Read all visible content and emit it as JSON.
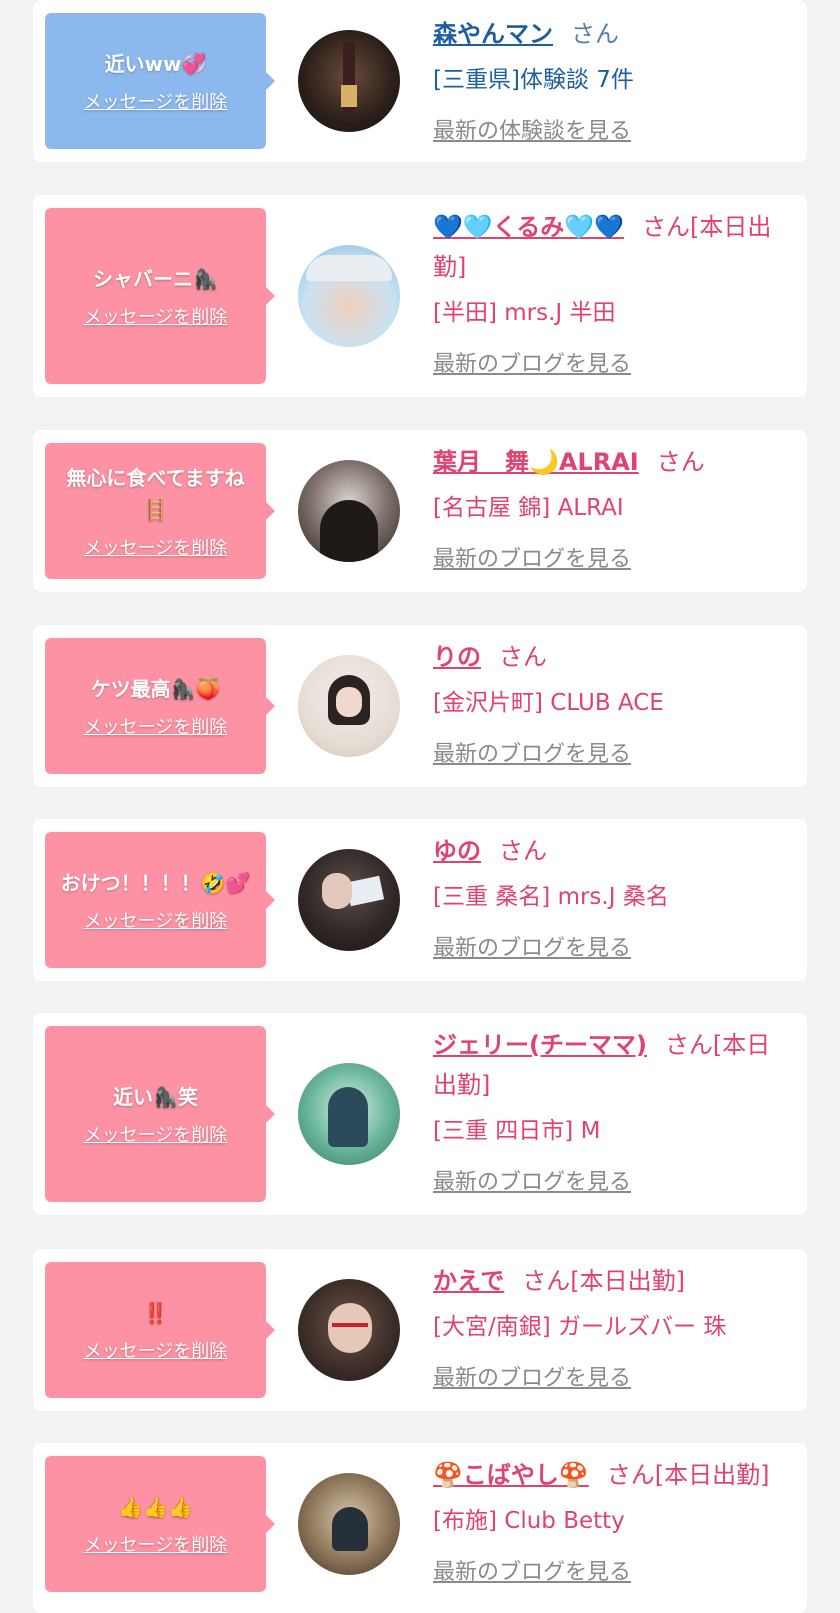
{
  "delete_label": "メッセージを削除",
  "cards": [
    {
      "message": "近いww💞",
      "name": "森やんマン",
      "suffix": "さん",
      "shop": "[三重県]体験談 7件",
      "link": "最新の体験談を見る",
      "theme": "blue"
    },
    {
      "message": "シャバーニ🦍",
      "name": "💙🩵くるみ🩵💙",
      "suffix": "さん[本日出勤]",
      "shop": "[半田] mrs.J 半田",
      "link": "最新のブログを見る",
      "theme": "pink"
    },
    {
      "message": "無心に食べてますね🪜",
      "name": "葉月　舞🌙ALRAI",
      "suffix": "さん",
      "shop": "[名古屋 錦] ALRAI",
      "link": "最新のブログを見る",
      "theme": "pink"
    },
    {
      "message": "ケツ最高🦍🍑",
      "name": "りの",
      "suffix": "さん",
      "shop": "[金沢片町] CLUB ACE",
      "link": "最新のブログを見る",
      "theme": "pink"
    },
    {
      "message": "おけつ！！！！🤣💕",
      "name": "ゆの",
      "suffix": "さん",
      "shop": "[三重 桑名] mrs.J 桑名",
      "link": "最新のブログを見る",
      "theme": "pink"
    },
    {
      "message": "近い🦍笑",
      "name": "ジェリー(チーママ)",
      "suffix": "さん[本日出勤]",
      "shop": "[三重 四日市] M",
      "link": "最新のブログを見る",
      "theme": "pink"
    },
    {
      "message": "‼️",
      "name": "かえで",
      "suffix": "さん[本日出勤]",
      "shop": "[大宮/南銀] ガールズバー 珠",
      "link": "最新のブログを見る",
      "theme": "pink"
    },
    {
      "message": "👍👍👍",
      "name": "🍄こばやし🍄",
      "suffix": "さん[本日出勤]",
      "shop": "[布施] Club Betty",
      "link": "最新のブログを見る",
      "theme": "pink"
    }
  ],
  "colors": {
    "pink": "#fc92a3",
    "blue": "#8db8ee",
    "pink_text": "#e0436d",
    "blue_text": "#1d5e9e",
    "link_gray": "#8a8a8a"
  }
}
